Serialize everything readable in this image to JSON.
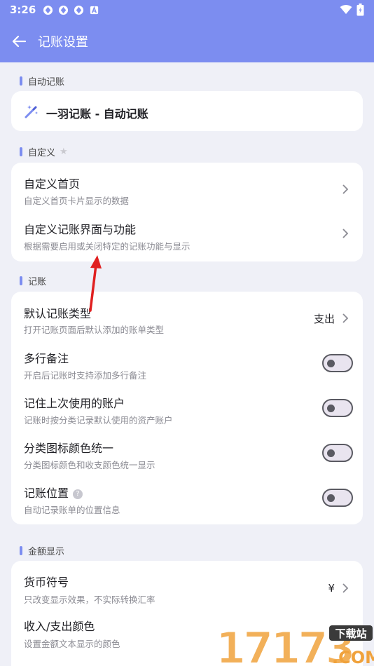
{
  "status": {
    "time": "3:26"
  },
  "appbar": {
    "title": "记账设置"
  },
  "sections": {
    "auto": {
      "header": "自动记账",
      "item": {
        "title": "一羽记账 - 自动记账"
      }
    },
    "custom": {
      "header": "自定义",
      "items": [
        {
          "title": "自定义首页",
          "subtitle": "自定义首页卡片显示的数据"
        },
        {
          "title": "自定义记账界面与功能",
          "subtitle": "根据需要启用或关闭特定的记账功能与显示"
        }
      ]
    },
    "bookkeeping": {
      "header": "记账",
      "items": [
        {
          "title": "默认记账类型",
          "subtitle": "打开记账页面后默认添加的账单类型",
          "value": "支出"
        },
        {
          "title": "多行备注",
          "subtitle": "开启后记账时支持添加多行备注",
          "toggle": false
        },
        {
          "title": "记住上次使用的账户",
          "subtitle": "记账时按分类记录默认使用的资产账户",
          "toggle": false
        },
        {
          "title": "分类图标颜色统一",
          "subtitle": "分类图标颜色和收支颜色统一显示",
          "toggle": false
        },
        {
          "title": "记账位置",
          "subtitle": "自动记录账单的位置信息",
          "toggle": false
        }
      ]
    },
    "amount": {
      "header": "金额显示",
      "items": [
        {
          "title": "货币符号",
          "subtitle": "只改变显示效果，不实际转换汇率",
          "value": "¥"
        },
        {
          "title": "收入/支出颜色",
          "subtitle": "设置金额文本显示的颜色"
        }
      ]
    }
  },
  "watermark": {
    "text": "17173",
    "badge": "下载站",
    "domain": ".COM"
  },
  "colors": {
    "accent": "#7c8df0",
    "background": "#eff0f7",
    "annotation_arrow": "#e02020"
  }
}
